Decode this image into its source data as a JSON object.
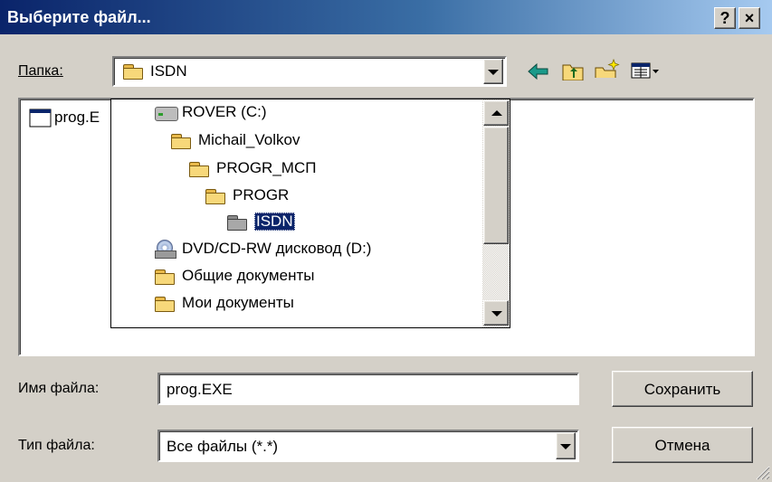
{
  "title": "Выберите файл...",
  "titlebar": {
    "help_label": "?",
    "close_label": "×"
  },
  "folder_bar": {
    "label": "Папка:",
    "value": "ISDN"
  },
  "file_list": {
    "items": [
      {
        "label": "prog.E"
      }
    ]
  },
  "tree_dropdown": {
    "items": [
      {
        "label": "ROVER (C:)",
        "icon": "hard-drive-icon"
      },
      {
        "label": "Michail_Volkov",
        "icon": "folder-user-icon"
      },
      {
        "label": "PROGR_МСП",
        "icon": "folder-icon"
      },
      {
        "label": "PROGR",
        "icon": "folder-icon"
      },
      {
        "label": "ISDN",
        "icon": "folder-open-icon",
        "selected": true
      },
      {
        "label": "DVD/CD-RW дисковод (D:)",
        "icon": "cd-drive-icon"
      },
      {
        "label": "Общие документы",
        "icon": "folder-icon"
      },
      {
        "label": "Мои документы",
        "icon": "folder-icon"
      }
    ]
  },
  "filename": {
    "label": "Имя файла:",
    "value": "prog.EXE"
  },
  "filetype": {
    "label": "Тип файла:",
    "value": "Все файлы (*.*)"
  },
  "buttons": {
    "save": "Сохранить",
    "cancel": "Отмена"
  },
  "colors": {
    "title_start": "#0a246a",
    "title_end": "#a6caf0",
    "face": "#d4d0c8",
    "selection": "#0a246a"
  }
}
